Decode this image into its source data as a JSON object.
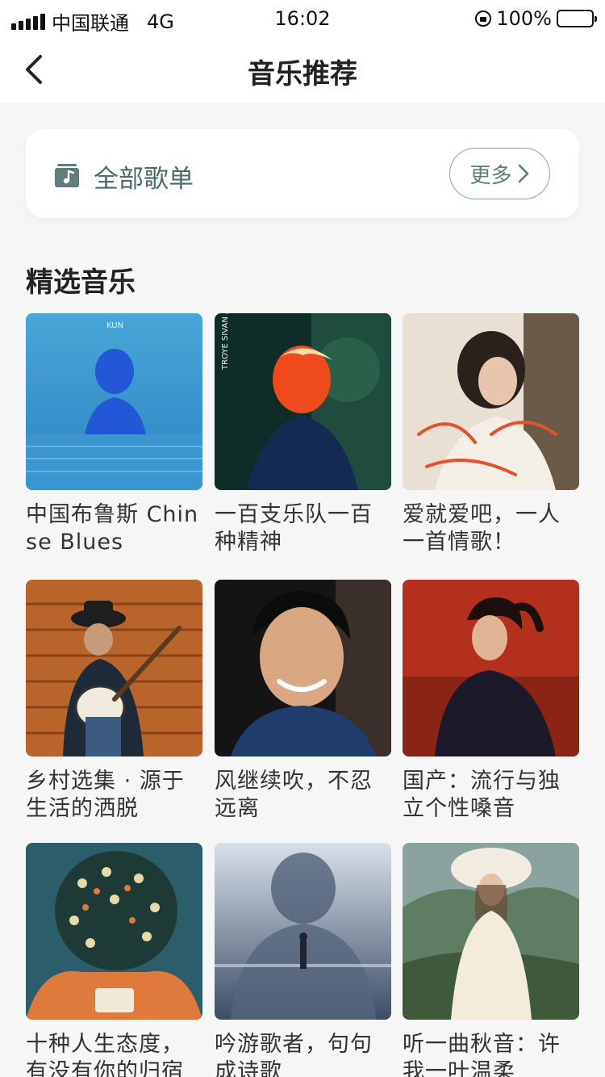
{
  "status_bar": {
    "carrier": "中国联通",
    "network": "4G",
    "time": "16:02",
    "battery": "100%"
  },
  "nav": {
    "title": "音乐推荐",
    "back_icon": "chevron-left-icon"
  },
  "playlist_card": {
    "label": "全部歌单",
    "icon": "music-folder-icon",
    "more_label": "更多"
  },
  "section": {
    "title": "精选音乐"
  },
  "items": [
    {
      "title": "中国布鲁斯 Chinse Blues",
      "cover_text": "KUN"
    },
    {
      "title": "一百支乐队一百种精神",
      "cover_text": "TROYE SIVAN ANIMAL"
    },
    {
      "title": "爱就爱吧，一人一首情歌！",
      "cover_text": ""
    },
    {
      "title": "乡村选集 · 源于生活的洒脱",
      "cover_text": ""
    },
    {
      "title": "风继续吹，不忍远离",
      "cover_text": ""
    },
    {
      "title": "国产：流行与独立个性嗓音",
      "cover_text": ""
    },
    {
      "title": "十种人生态度，有没有你的归宿",
      "cover_text": ""
    },
    {
      "title": "吟游歌者，句句成诗歌",
      "cover_text": ""
    },
    {
      "title": "听一曲秋音：许我一叶温柔",
      "cover_text": ""
    }
  ],
  "colors": {
    "accent": "#5e7d7b",
    "background": "#f6f6f7"
  }
}
